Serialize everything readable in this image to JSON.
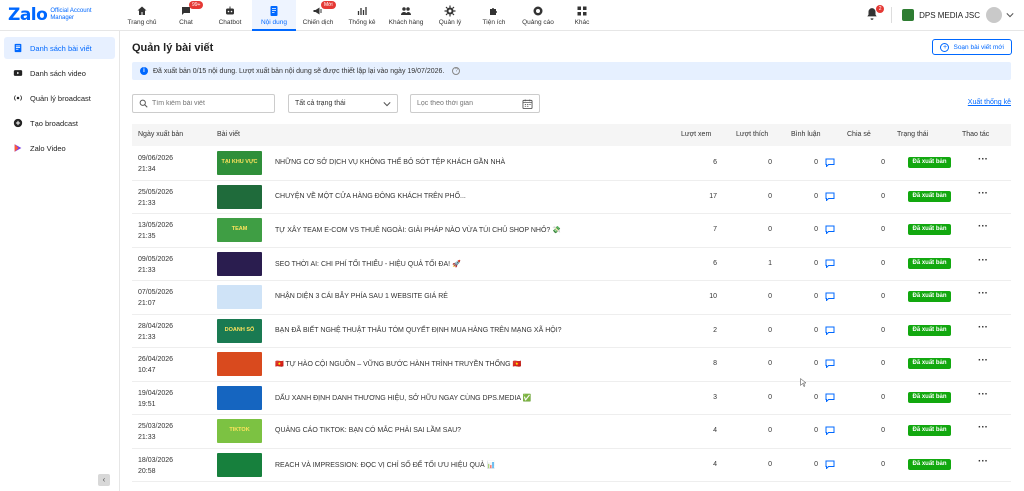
{
  "app": {
    "logo_text": "Zalo",
    "logo_sub_line1": "Official Account",
    "logo_sub_line2": "Manager"
  },
  "nav": [
    {
      "label": "Trang chủ",
      "icon": "home-icon",
      "badge": ""
    },
    {
      "label": "Chat",
      "icon": "chat-icon",
      "badge": "99+"
    },
    {
      "label": "Chatbot",
      "icon": "robot-icon",
      "badge": ""
    },
    {
      "label": "Nội dung",
      "icon": "document-icon",
      "badge": "",
      "active": true
    },
    {
      "label": "Chiến dịch",
      "icon": "megaphone-icon",
      "badge": "Mới"
    },
    {
      "label": "Thống kê",
      "icon": "chart-icon",
      "badge": ""
    },
    {
      "label": "Khách hàng",
      "icon": "people-icon",
      "badge": ""
    },
    {
      "label": "Quản lý",
      "icon": "gear-icon",
      "badge": ""
    },
    {
      "label": "Tiện ích",
      "icon": "puzzle-icon",
      "badge": ""
    },
    {
      "label": "Quảng cáo",
      "icon": "ads-icon",
      "badge": ""
    },
    {
      "label": "Khác",
      "icon": "grid-icon",
      "badge": ""
    }
  ],
  "header_right": {
    "bell_count": "2",
    "account_name": "DPS MEDIA JSC"
  },
  "sidebar": {
    "items": [
      {
        "label": "Danh sách bài viết",
        "icon": "article-icon",
        "active": true
      },
      {
        "label": "Danh sách video",
        "icon": "video-icon",
        "active": false
      },
      {
        "label": "Quản lý broadcast",
        "icon": "broadcast-icon",
        "active": false
      },
      {
        "label": "Tạo broadcast",
        "icon": "plus-circle-icon",
        "active": false
      },
      {
        "label": "Zalo Video",
        "icon": "zalo-video-icon",
        "active": false
      }
    ]
  },
  "main": {
    "title": "Quản lý bài viết",
    "new_post_label": "Soạn bài viết mới",
    "notice": "Đã xuất bản 0/15 nội dung. Lượt xuất bản nội dung sẽ được thiết lập lại vào ngày 19/07/2026.",
    "search_placeholder": "Tìm kiếm bài viết",
    "status_value": "Tất cả trạng thái",
    "date_placeholder": "Lọc theo thời gian",
    "export_label": "Xuất thống kê"
  },
  "table": {
    "headers": {
      "date": "Ngày xuất bản",
      "post": "Bài viết",
      "views": "Lượt xem",
      "likes": "Lượt thích",
      "comments": "Bình luận",
      "shares": "Chia sẻ",
      "status": "Trạng thái",
      "actions": "Thao tác"
    },
    "rows": [
      {
        "date": "09/06/2026",
        "time": "21:34",
        "title": "NHỮNG CƠ SỞ DỊCH VỤ KHÔNG THỂ BỎ SÓT TỆP KHÁCH GẦN NHÀ",
        "views": "6",
        "likes": "0",
        "comments": "0",
        "shares": "0",
        "status": "Đã xuất bản",
        "thumb_color": "#2f8f3a",
        "thumb_text": "TẠI KHU VỰC"
      },
      {
        "date": "25/05/2026",
        "time": "21:33",
        "title": "CHUYỆN VỀ MỘT CỬA HÀNG ĐÔNG KHÁCH TRÊN PHỐ...",
        "views": "17",
        "likes": "0",
        "comments": "0",
        "shares": "0",
        "status": "Đã xuất bản",
        "thumb_color": "#1f6b3b",
        "thumb_text": ""
      },
      {
        "date": "13/05/2026",
        "time": "21:35",
        "title": "TỰ XÂY TEAM E-COM VS THUÊ NGOÀI: GIẢI PHÁP NÀO VỪA TÚI CHỦ SHOP NHỎ? 💸",
        "views": "7",
        "likes": "0",
        "comments": "0",
        "shares": "0",
        "status": "Đã xuất bản",
        "thumb_color": "#3f9e44",
        "thumb_text": "TEAM"
      },
      {
        "date": "09/05/2026",
        "time": "21:33",
        "title": "SEO THỜI AI: CHI PHÍ TỐI THIỂU - HIỆU QUẢ TỐI ĐA! 🚀",
        "views": "6",
        "likes": "1",
        "comments": "0",
        "shares": "0",
        "status": "Đã xuất bản",
        "thumb_color": "#2a1d4f",
        "thumb_text": ""
      },
      {
        "date": "07/05/2026",
        "time": "21:07",
        "title": "NHẬN DIỆN 3 CÁI BẪY PHÍA SAU 1 WEBSITE GIÁ RẺ",
        "views": "10",
        "likes": "0",
        "comments": "0",
        "shares": "0",
        "status": "Đã xuất bản",
        "thumb_color": "#cfe3f7",
        "thumb_text": ""
      },
      {
        "date": "28/04/2026",
        "time": "21:33",
        "title": "BẠN ĐÃ BIẾT NGHỆ THUẬT THÂU TÓM QUYẾT ĐỊNH MUA HÀNG TRÊN MẠNG XÃ HỘI?",
        "views": "2",
        "likes": "0",
        "comments": "0",
        "shares": "0",
        "status": "Đã xuất bản",
        "thumb_color": "#1a7a52",
        "thumb_text": "DOANH SỐ"
      },
      {
        "date": "26/04/2026",
        "time": "10:47",
        "title": "🇻🇳 TỰ HÀO CỘI NGUỒN – VỮNG BƯỚC HÀNH TRÌNH TRUYỀN THỐNG 🇻🇳",
        "views": "8",
        "likes": "0",
        "comments": "0",
        "shares": "0",
        "status": "Đã xuất bản",
        "thumb_color": "#d94a1e",
        "thumb_text": ""
      },
      {
        "date": "19/04/2026",
        "time": "19:51",
        "title": "DẤU XANH ĐỊNH DANH THƯƠNG HIỆU, SỞ HỮU NGAY CÙNG DPS.MEDIA ✅",
        "views": "3",
        "likes": "0",
        "comments": "0",
        "shares": "0",
        "status": "Đã xuất bản",
        "thumb_color": "#1565c0",
        "thumb_text": ""
      },
      {
        "date": "25/03/2026",
        "time": "21:33",
        "title": "QUẢNG CÁO TIKTOK: BẠN CÓ MẮC PHẢI SAI LẦM SAU?",
        "views": "4",
        "likes": "0",
        "comments": "0",
        "shares": "0",
        "status": "Đã xuất bản",
        "thumb_color": "#7cc242",
        "thumb_text": "TIKTOK"
      },
      {
        "date": "18/03/2026",
        "time": "20:58",
        "title": "REACH VÀ IMPRESSION: ĐỌC VỊ CHỈ SỐ ĐỂ TỐI ƯU HIỆU QUẢ 📊",
        "views": "4",
        "likes": "0",
        "comments": "0",
        "shares": "0",
        "status": "Đã xuất bản",
        "thumb_color": "#17803d",
        "thumb_text": ""
      }
    ]
  },
  "colors": {
    "brand": "#0068ff",
    "published": "#12a80f",
    "notice_bg": "#e6f0ff"
  }
}
